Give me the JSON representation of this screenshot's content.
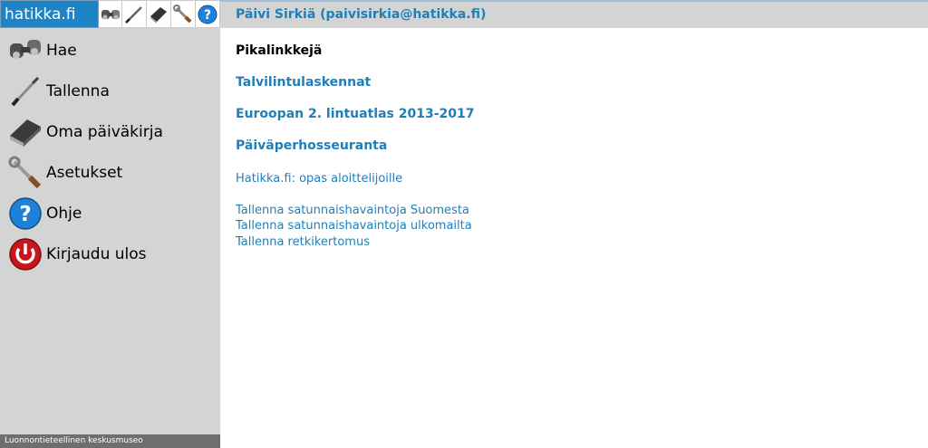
{
  "app": {
    "brand": "hatikka.fi"
  },
  "toolbar": {
    "icons": [
      "binoculars-icon",
      "pen-icon",
      "book-icon",
      "wrench-icon",
      "help-icon"
    ]
  },
  "menu": {
    "items": [
      {
        "label": "Hae",
        "icon": "binoculars-icon"
      },
      {
        "label": "Tallenna",
        "icon": "pen-icon"
      },
      {
        "label": "Oma päiväkirja",
        "icon": "book-icon"
      },
      {
        "label": "Asetukset",
        "icon": "wrench-icon"
      },
      {
        "label": "Ohje",
        "icon": "help-icon"
      },
      {
        "label": "Kirjaudu ulos",
        "icon": "power-icon"
      }
    ]
  },
  "footer": {
    "text": "Luonnontieteellinen keskusmuseo"
  },
  "header": {
    "user": "Päivi Sirkiä (paivisirkia@hatikka.fi)"
  },
  "main": {
    "title": "Pikalinkkejä",
    "primary_links": [
      "Talvilintulaskennat",
      "Euroopan 2. lintuatlas 2013-2017",
      "Päiväperhosseuranta"
    ],
    "guide_link": "Hatikka.fi: opas aloittelijoille",
    "secondary_links": [
      "Tallenna satunnaishavaintoja Suomesta",
      "Tallenna satunnaishavaintoja ulkomailta",
      "Tallenna retkikertomus"
    ]
  },
  "colors": {
    "brand": "#1f84c5",
    "link": "#1f7fb9",
    "sidebar": "#d4d4d4",
    "danger": "#c8161d"
  }
}
